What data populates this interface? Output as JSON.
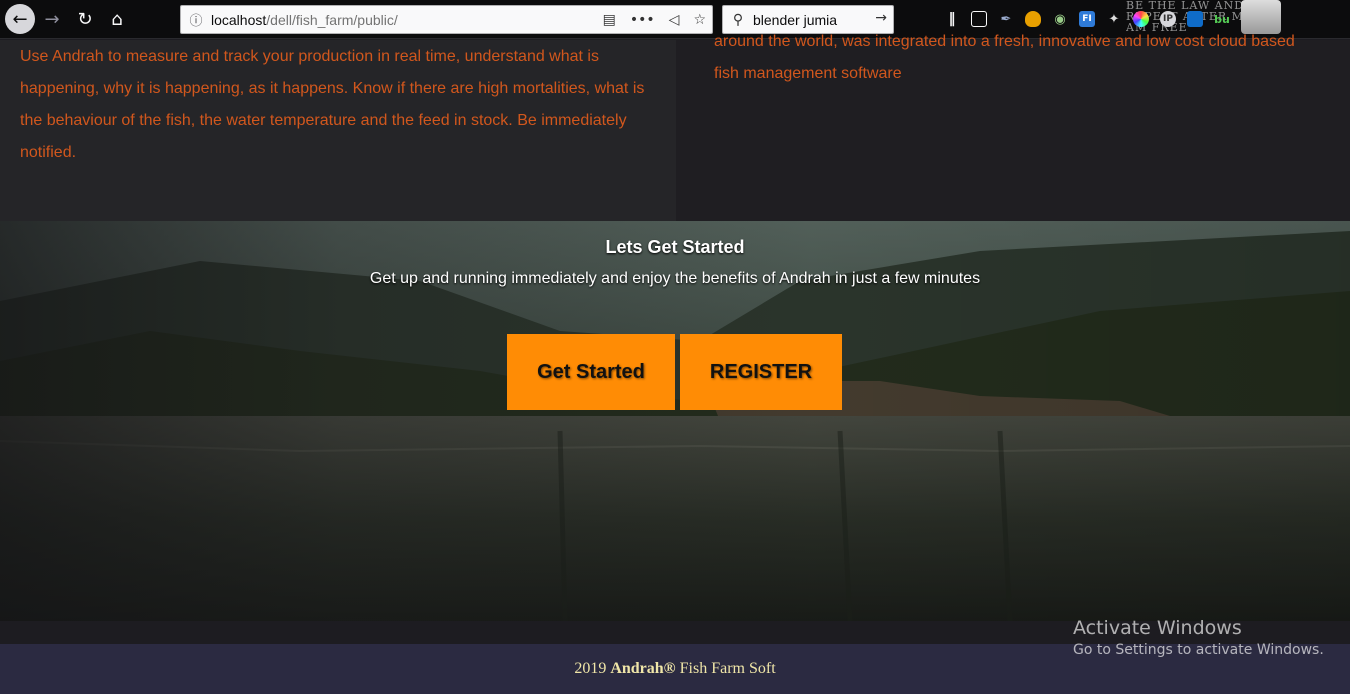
{
  "browser": {
    "url_host": "localhost",
    "url_path": "/dell/fish_farm/public/",
    "search_value": "blender jumia",
    "overflow_icon_text": "•••",
    "extension_labels": {
      "fi": "FI",
      "ip": "IP",
      "bu": "bu"
    },
    "watermark_text": "BE THE LAW AND REPEAT AFTER ME I AM FREE"
  },
  "about": {
    "left_text": "Use Andrah to measure and track your production in real time, understand what is happening, why it is happening, as it happens. Know if there are high mortalities, what is the behaviour of the fish, the water temperature and the feed in stock. Be immediately notified.",
    "right_text": "around the world, was integrated into a fresh, innovative and low cost cloud based fish management software"
  },
  "hero": {
    "title": "Lets Get Started",
    "subtitle": "Get up and running immediately and enjoy the benefits of Andrah in just a few minutes",
    "get_started_label": "Get Started",
    "register_label": "REGISTER"
  },
  "footer": {
    "year": "2019",
    "brand": "Andrah®",
    "suffix": "Fish Farm Soft"
  },
  "windows": {
    "activate_title": "Activate Windows",
    "activate_sub": "Go to Settings to activate Windows."
  },
  "colors": {
    "accent_orange": "#ff8c05",
    "body_text_orange": "#d1571d",
    "footer_bg": "#2b2a41"
  }
}
